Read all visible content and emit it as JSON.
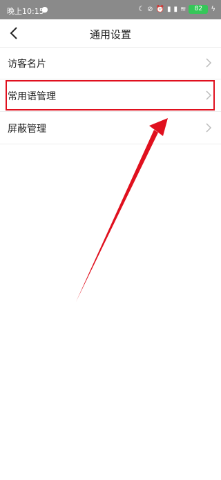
{
  "status_bar": {
    "time": "晚上10:15",
    "battery": "82",
    "icons": [
      "wechat-icon",
      "moon-icon",
      "mute-icon",
      "alarm-icon",
      "signal-icon",
      "signal-icon-2",
      "wifi-icon",
      "battery-icon",
      "charging-icon"
    ]
  },
  "nav": {
    "back_icon": "back-chevron-icon",
    "title": "通用设置"
  },
  "list": {
    "items": [
      {
        "label": "访客名片"
      },
      {
        "label": "常用语管理"
      },
      {
        "label": "屏蔽管理"
      }
    ]
  },
  "annotation": {
    "highlight_color": "#e0101e",
    "arrow_color": "#e0101e"
  }
}
